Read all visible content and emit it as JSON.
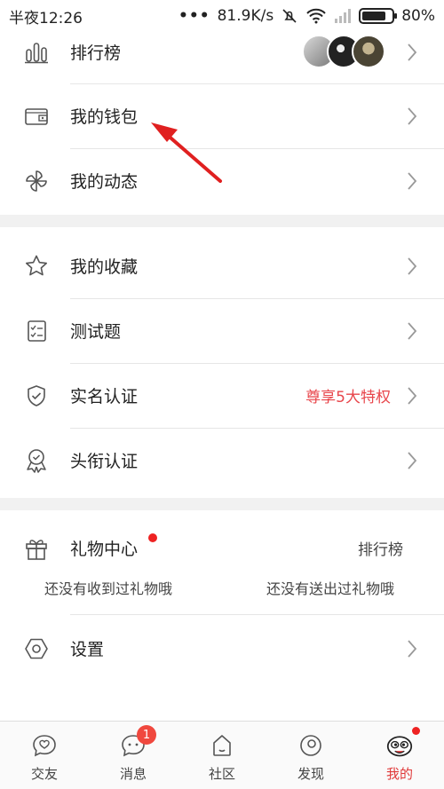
{
  "status_bar": {
    "time": "半夜12:26",
    "network_speed": "81.9K/s",
    "battery": "80%",
    "battery_level": 0.8
  },
  "menu_section_1": [
    {
      "label": "排行榜",
      "icon": "leaderboard-icon"
    },
    {
      "label": "我的钱包",
      "icon": "wallet-icon"
    },
    {
      "label": "我的动态",
      "icon": "pinwheel-icon"
    }
  ],
  "menu_section_2": [
    {
      "label": "我的收藏",
      "icon": "star-icon"
    },
    {
      "label": "测试题",
      "icon": "quiz-icon"
    },
    {
      "label": "实名认证",
      "icon": "shield-check-icon",
      "extra": "尊享5大特权"
    },
    {
      "label": "头衔认证",
      "icon": "medal-icon"
    }
  ],
  "gift_center": {
    "label": "礼物中心",
    "ranking_link": "排行榜",
    "received_text": "还没有收到过礼物哦",
    "sent_text": "还没有送出过礼物哦"
  },
  "settings": {
    "label": "设置"
  },
  "bottom_nav": [
    {
      "label": "交友",
      "icon": "heart-chat-icon"
    },
    {
      "label": "消息",
      "icon": "message-icon",
      "badge": "1"
    },
    {
      "label": "社区",
      "icon": "community-icon"
    },
    {
      "label": "发现",
      "icon": "discover-icon"
    },
    {
      "label": "我的",
      "icon": "profile-avatar-icon",
      "active": true
    }
  ],
  "colors": {
    "accent": "#e8464b",
    "badge": "#f0483e",
    "divider": "#e6e6e6",
    "section_gap": "#f1f1f1",
    "annotation_arrow": "#e02020"
  }
}
